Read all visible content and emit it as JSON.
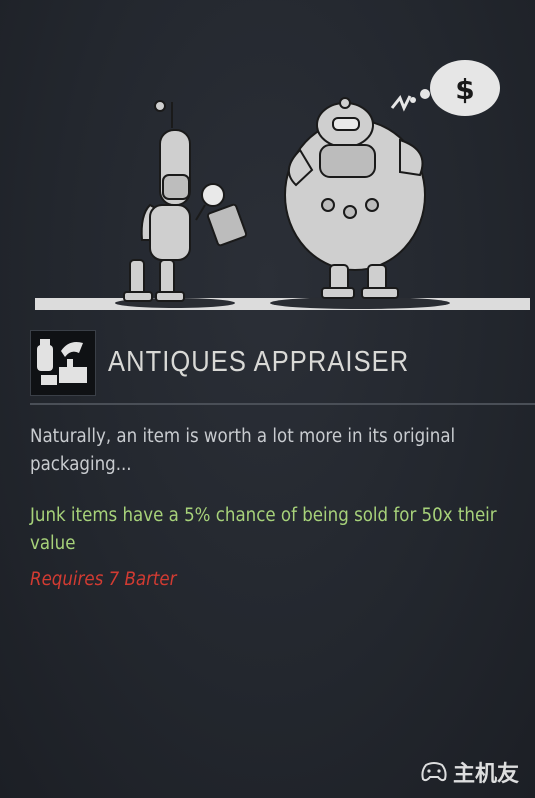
{
  "perk": {
    "title": "ANTIQUES APPRAISER",
    "description": "Naturally, an item is worth a lot more in its original packaging...",
    "effect": "Junk items have a 5% chance of being sold for 50x their value",
    "requirement": "Requires 7 Barter"
  },
  "illustration": {
    "thought_symbol": "$"
  },
  "watermark": {
    "text": "主机友",
    "icon": "gamepad-icon"
  },
  "colors": {
    "background": "#23272e",
    "title": "#d9d9d6",
    "description": "#c9ccd0",
    "effect": "#a7d27a",
    "requirement": "#d23b32"
  }
}
